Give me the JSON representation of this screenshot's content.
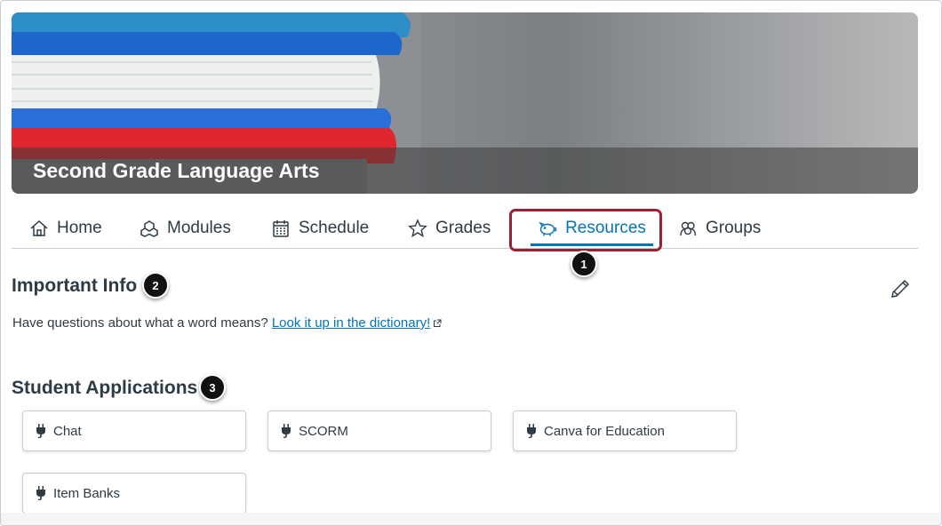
{
  "course": {
    "title": "Second Grade Language Arts"
  },
  "tabs": [
    {
      "label": "Home",
      "icon": "home-icon"
    },
    {
      "label": "Modules",
      "icon": "modules-icon"
    },
    {
      "label": "Schedule",
      "icon": "calendar-icon"
    },
    {
      "label": "Grades",
      "icon": "star-icon"
    },
    {
      "label": "Resources",
      "icon": "piggy-bank-icon",
      "active": true
    },
    {
      "label": "Groups",
      "icon": "groups-icon"
    }
  ],
  "markers": {
    "m1": "1",
    "m2": "2",
    "m3": "3"
  },
  "important_info": {
    "heading": "Important Info",
    "text": "Have questions about what a word means? ",
    "link_text": "Look it up in the dictionary!"
  },
  "student_apps": {
    "heading": "Student Applications",
    "apps": [
      "Chat",
      "SCORM",
      "Canva for Education",
      "Item Banks"
    ]
  },
  "colors": {
    "accent": "#0374b5",
    "highlight": "#9b2233",
    "text": "#2d3b45"
  }
}
